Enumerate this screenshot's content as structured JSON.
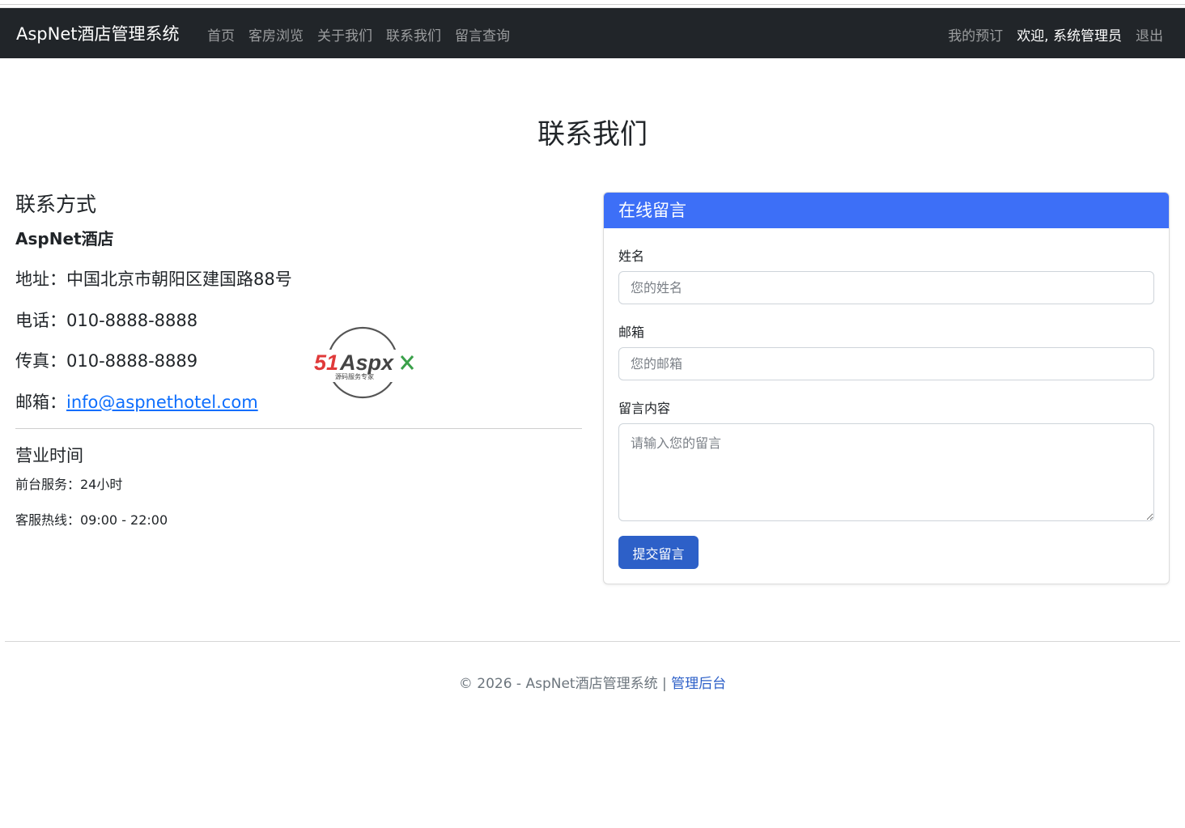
{
  "navbar": {
    "brand": "AspNet酒店管理系统",
    "left_links": [
      {
        "label": "首页"
      },
      {
        "label": "客房浏览"
      },
      {
        "label": "关于我们"
      },
      {
        "label": "联系我们"
      },
      {
        "label": "留言查询"
      }
    ],
    "right_links": {
      "my_bookings": "我的预订",
      "welcome": "欢迎, 系统管理员",
      "logout": "退出"
    }
  },
  "page": {
    "title": "联系我们"
  },
  "contact": {
    "heading": "联系方式",
    "hotel_name": "AspNet酒店",
    "address_label": "地址：",
    "address": "中国北京市朝阳区建国路88号",
    "phone_label": "电话：",
    "phone": "010-8888-8888",
    "fax_label": "传真：",
    "fax": "010-8888-8889",
    "email_label": "邮箱：",
    "email": "info@aspnethotel.com",
    "hours_heading": "营业时间",
    "front_desk": "前台服务：24小时",
    "hotline": "客服热线：09:00 - 22:00"
  },
  "watermark": {
    "text_red": "51",
    "text_dark": "Aspx",
    "subtitle": "源码服务专家"
  },
  "message_form": {
    "header": "在线留言",
    "name_label": "姓名",
    "name_placeholder": "您的姓名",
    "name_value": "",
    "email_label": "邮箱",
    "email_placeholder": "您的邮箱",
    "email_value": "",
    "content_label": "留言内容",
    "content_placeholder": "请输入您的留言",
    "content_value": "",
    "submit_label": "提交留言"
  },
  "footer": {
    "copyright": "© 2026 - AspNet酒店管理系统 | ",
    "admin_link": "管理后台"
  },
  "colors": {
    "navbar_bg": "#212529",
    "card_header_bg": "#3d6ff7",
    "button_bg": "#2d60c8",
    "link": "#0d6efd"
  }
}
